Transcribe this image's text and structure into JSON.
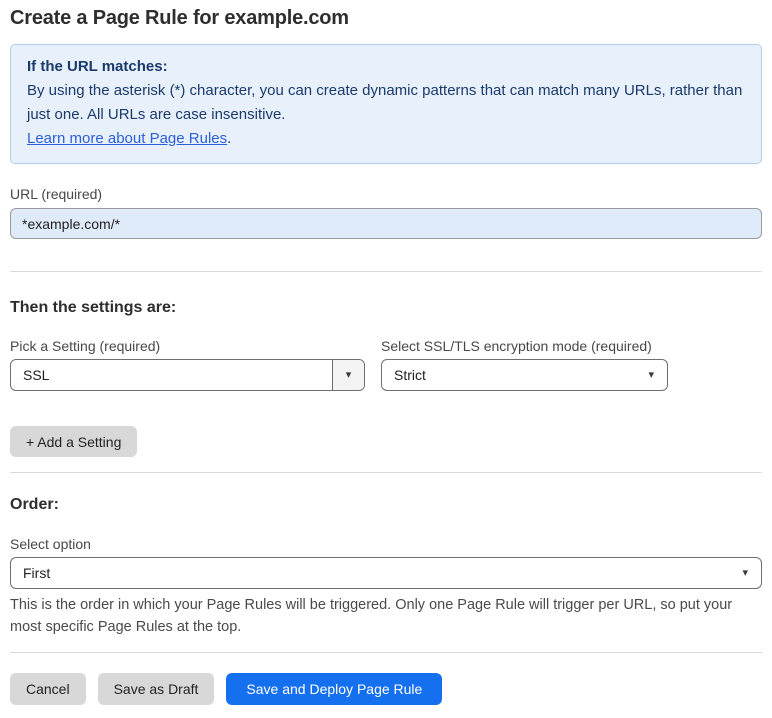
{
  "page": {
    "title": "Create a Page Rule for example.com"
  },
  "info_box": {
    "heading": "If the URL matches:",
    "body": "By using the asterisk (*) character, you can create dynamic patterns that can match many URLs, rather than just one. All URLs are case insensitive.",
    "link_label": "Learn more about Page Rules",
    "link_suffix": "."
  },
  "url_field": {
    "label": "URL (required)",
    "value": "*example.com/*"
  },
  "settings_section": {
    "heading": "Then the settings are:",
    "setting_picker": {
      "label": "Pick a Setting (required)",
      "selected": "SSL"
    },
    "mode_picker": {
      "label": "Select SSL/TLS encryption mode (required)",
      "selected": "Strict"
    },
    "add_setting_label": "+ Add a Setting"
  },
  "order_section": {
    "heading": "Order:",
    "select_label": "Select option",
    "selected": "First",
    "help_text": "This is the order in which your Page Rules will be triggered. Only one Page Rule will trigger per URL, so put your most specific Page Rules at the top."
  },
  "actions": {
    "cancel_label": "Cancel",
    "save_draft_label": "Save as Draft",
    "save_deploy_label": "Save and Deploy Page Rule"
  },
  "icons": {
    "chevron_down": "▾"
  },
  "colors": {
    "info_background": "#e8f1fb",
    "info_border": "#b3cfec",
    "info_text": "#1a3a6b",
    "link": "#2c5ed9",
    "input_background": "#e0ebfa",
    "primary_button": "#1570f0",
    "gray_button": "#d8d8d8",
    "divider": "#d9d9d9"
  }
}
